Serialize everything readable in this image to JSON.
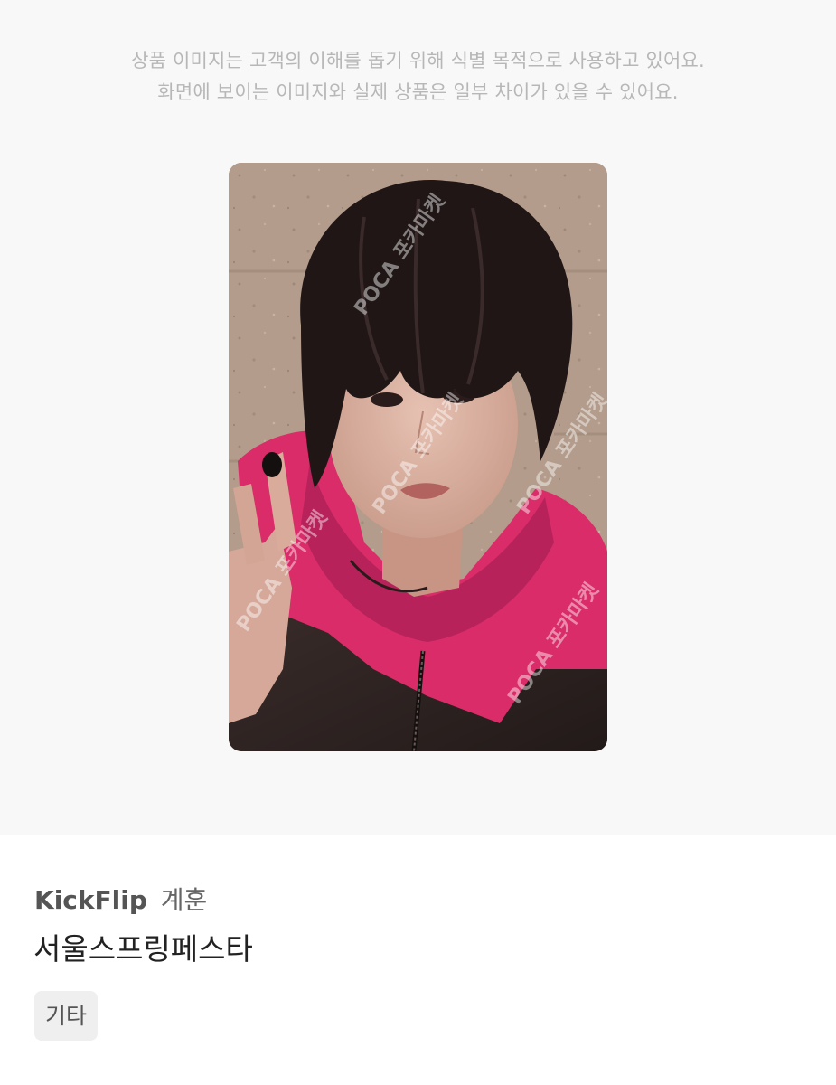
{
  "notice": {
    "line1": "상품 이미지는 고객의 이해를 돕기 위해 식별 목적으로 사용하고 있어요.",
    "line2": "화면에 보이는 이미지와 실제 상품은 일부 차이가 있을 수 있어요."
  },
  "product": {
    "group": "KickFlip",
    "member": "계훈",
    "title": "서울스프링페스타",
    "tag": "기타",
    "watermark": "POCA 포카마켓"
  },
  "colors": {
    "hoodie": "#e0326e",
    "background_top": "#f8f8f8"
  }
}
